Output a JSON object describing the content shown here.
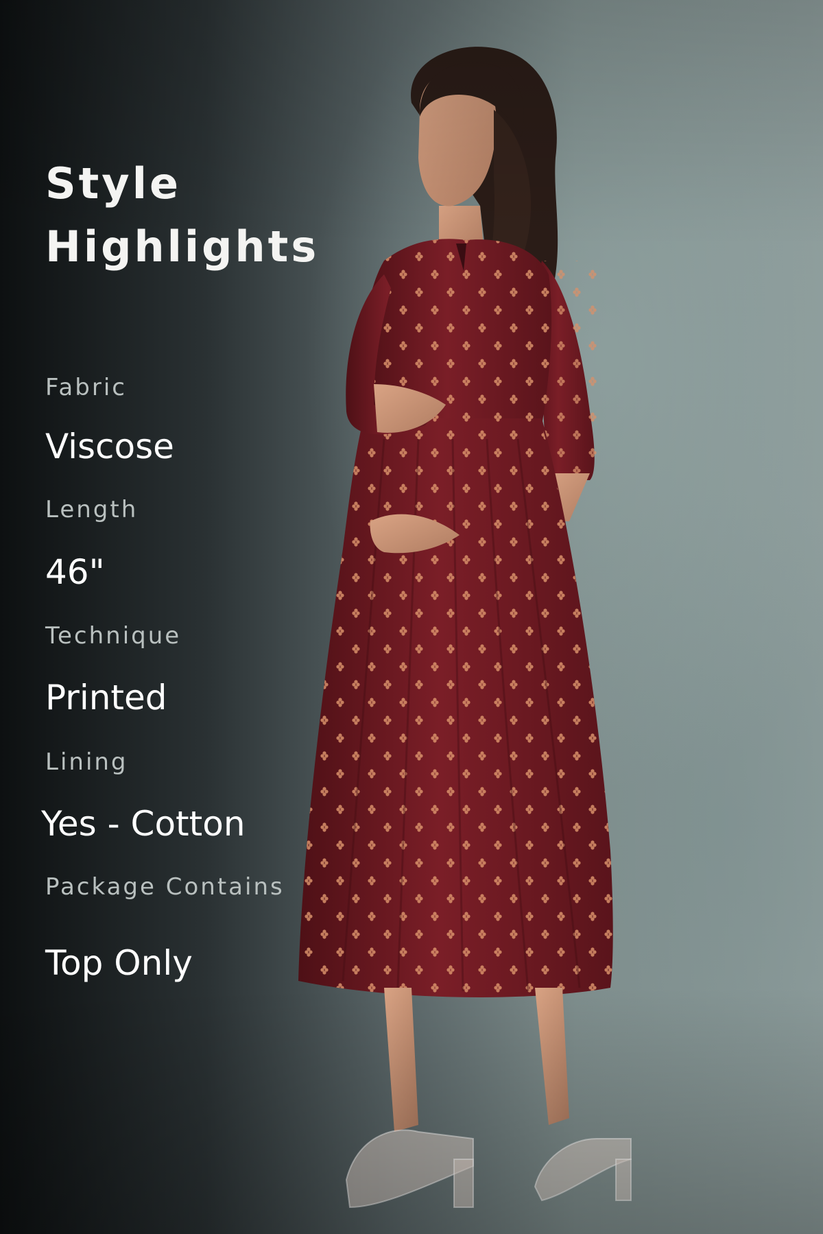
{
  "title": "Style Highlights",
  "title_line1": "Style",
  "title_line2": "Highlights",
  "specs": [
    {
      "label": "Fabric",
      "value": "Viscose"
    },
    {
      "label": "Length",
      "value": "46\""
    },
    {
      "label": "Technique",
      "value": "Printed"
    },
    {
      "label": "Lining",
      "value": "Yes - Cotton"
    },
    {
      "label": "Package Contains",
      "value": "Top Only"
    }
  ],
  "colors": {
    "dress": "#6e1a22",
    "dress_dot": "#d9906a",
    "text": "#ffffff",
    "label_text": "#b9c0bf"
  }
}
